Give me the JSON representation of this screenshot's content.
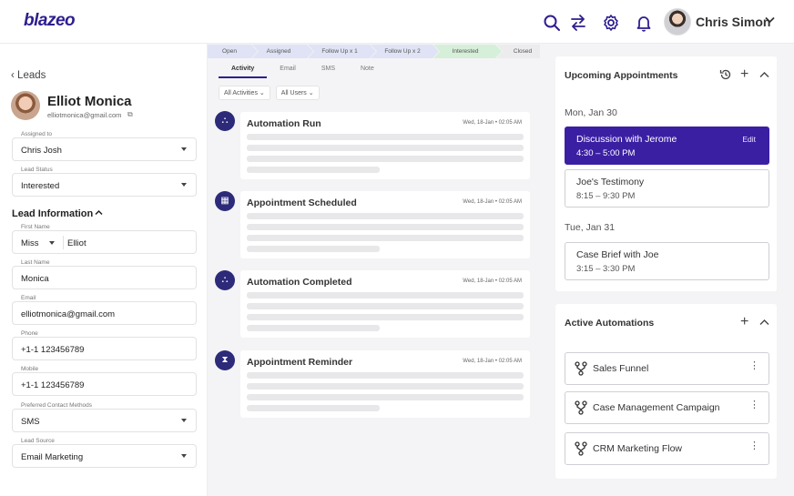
{
  "app": {
    "logo": "blazeo"
  },
  "header": {
    "user_name": "Chris Simon",
    "icons": [
      "search-icon",
      "swap-icon",
      "gear-icon",
      "bell-icon"
    ]
  },
  "lead": {
    "back_label": "Leads",
    "name": "Elliot Monica",
    "email": "elliotmonica@gmail.com",
    "assigned_to": {
      "label": "Assigned to",
      "value": "Chris Josh"
    },
    "lead_status": {
      "label": "Lead Status",
      "value": "Interested"
    },
    "section_title": "Lead Information",
    "first_name": {
      "label": "First Name",
      "title": "Miss",
      "value": "Elliot"
    },
    "last_name": {
      "label": "Last Name",
      "value": "Monica"
    },
    "email_field": {
      "label": "Email",
      "value": "elliotmonica@gmail.com"
    },
    "phone": {
      "label": "Phone",
      "value": "+1-1 123456789"
    },
    "mobile": {
      "label": "Mobile",
      "value": "+1-1 123456789"
    },
    "contact_methods": {
      "label": "Preferred Contact Methods",
      "value": "SMS"
    },
    "lead_source": {
      "label": "Lead Source",
      "value": "Email Marketing"
    }
  },
  "pipeline": {
    "stages": [
      "Open",
      "Assigned",
      "Follow Up x 1",
      "Follow Up x 2",
      "Interested",
      "Closed"
    ]
  },
  "activity": {
    "tabs": [
      "Activity",
      "Email",
      "SMS",
      "Note"
    ],
    "filters": [
      "All Activities",
      "All Users"
    ],
    "items": [
      {
        "title": "Automation Run",
        "time": "Wed, 18-Jan • 02:05 AM"
      },
      {
        "title": "Appointment Scheduled",
        "time": "Wed, 18-Jan • 02:05 AM"
      },
      {
        "title": "Automation Completed",
        "time": "Wed, 18-Jan • 02:05 AM"
      },
      {
        "title": "Appointment Reminder",
        "time": "Wed, 18-Jan • 02:05 AM"
      }
    ]
  },
  "appointments": {
    "title": "Upcoming Appointments",
    "days": [
      {
        "label": "Mon, Jan 30"
      },
      {
        "label": "Tue, Jan 31"
      }
    ],
    "items": [
      {
        "title": "Discussion with Jerome",
        "time": "4:30 – 5:00 PM",
        "edit": "Edit"
      },
      {
        "title": "Joe's Testimony",
        "time": "8:15 – 9:30 PM"
      },
      {
        "title": "Case Brief with Joe",
        "time": "3:15 – 3:30 PM"
      }
    ]
  },
  "automations": {
    "title": "Active Automations",
    "items": [
      "Sales Funnel",
      "Case Management Campaign",
      "CRM Marketing Flow"
    ]
  },
  "colors": {
    "brand": "#2d1e8f",
    "active_card": "#3b1fa3",
    "accent_flame": "#e9402c"
  }
}
